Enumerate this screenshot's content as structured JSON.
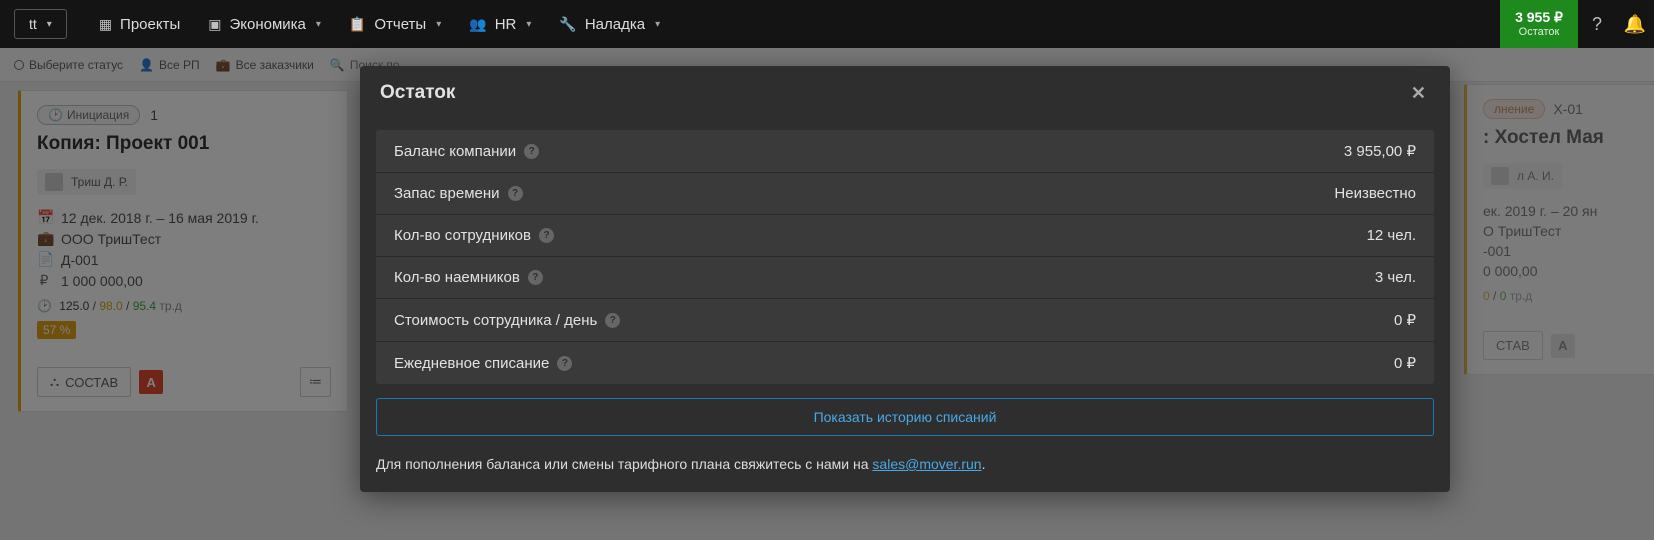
{
  "topnav": {
    "brand": "tt",
    "items": [
      {
        "icon": "▦",
        "label": "Проекты",
        "caret": false
      },
      {
        "icon": "▣",
        "label": "Экономика",
        "caret": true
      },
      {
        "icon": "📋",
        "label": "Отчеты",
        "caret": true
      },
      {
        "icon": "👥",
        "label": "HR",
        "caret": true
      },
      {
        "icon": "🔧",
        "label": "Наладка",
        "caret": true
      }
    ],
    "balance_amount": "3 955 ₽",
    "balance_label": "Остаток"
  },
  "filters": {
    "status": "Выберите статус",
    "rp": "Все РП",
    "customers": "Все заказчики",
    "search_placeholder": "Поиск по"
  },
  "card1": {
    "stage": "Инициация",
    "stage_count": "1",
    "title": "Копия: Проект 001",
    "assignee": "Триш Д. Р.",
    "dates": "12 дек. 2018 г. – 16 мая 2019 г.",
    "company": "ООО ТришТест",
    "doc": "Д-001",
    "money": "1 000 000,00",
    "trd_a": "125.0",
    "trd_b": "98.0",
    "trd_c": "95.4",
    "trd_lbl": "тр.д",
    "pct": "57 %",
    "sostav": "СОСТАВ",
    "a_badge": "А"
  },
  "card2": {
    "stage_partial": "лнение",
    "code": "Х-01",
    "title_partial": ": Хостел Мая",
    "assignee_partial": "л А. И.",
    "dates_partial": "ек. 2019 г. – 20 ян",
    "company_partial": "О ТришТест",
    "doc_partial": "-001",
    "money_partial": "0 000,00",
    "trd_partial_b": "0",
    "trd_partial_c": "0",
    "trd_lbl": "тр.д",
    "sostav": "СТАВ",
    "a_badge": "А"
  },
  "modal": {
    "title": "Остаток",
    "rows": [
      {
        "k": "Баланс компании",
        "v": "3 955,00 ₽"
      },
      {
        "k": "Запас времени",
        "v": "Неизвестно"
      },
      {
        "k": "Кол-во сотрудников",
        "v": "12 чел."
      },
      {
        "k": "Кол-во наемников",
        "v": "3 чел."
      },
      {
        "k": "Стоимость сотрудника / день",
        "v": "0 ₽"
      },
      {
        "k": "Ежедневное списание",
        "v": "0 ₽"
      }
    ],
    "history_btn": "Показать историю списаний",
    "footer_pre": "Для пополнения баланса или смены тарифного плана свяжитесь с нами на ",
    "footer_link": "sales@mover.run",
    "footer_post": "."
  }
}
